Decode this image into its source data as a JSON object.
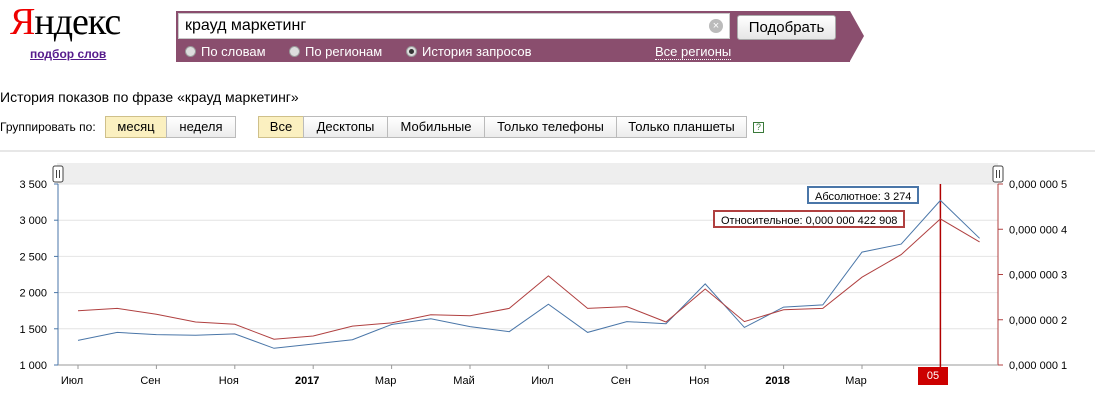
{
  "header": {
    "logo_first": "Я",
    "logo_rest": "ндекс",
    "sublink": "подбор слов",
    "search_value": "крауд маркетинг",
    "clear_glyph": "×",
    "submit_label": "Подобрать",
    "radios": [
      {
        "label": "По словам",
        "selected": false
      },
      {
        "label": "По регионам",
        "selected": false
      },
      {
        "label": "История запросов",
        "selected": true
      }
    ],
    "regions_link": "Все регионы",
    "bar_color": "#8a4e6e"
  },
  "main": {
    "heading": "История показов по фразе «крауд маркетинг»",
    "group_label": "Группировать по:",
    "group_buttons": [
      {
        "label": "месяц",
        "active": true
      },
      {
        "label": "неделя",
        "active": false
      }
    ],
    "device_buttons": [
      {
        "label": "Все",
        "active": true
      },
      {
        "label": "Десктопы",
        "active": false
      },
      {
        "label": "Мобильные",
        "active": false
      },
      {
        "label": "Только телефоны",
        "active": false
      },
      {
        "label": "Только планшеты",
        "active": false
      }
    ],
    "help_glyph": "?"
  },
  "chart_data": {
    "type": "line",
    "x_tick_labels": [
      "Июл",
      "Сен",
      "Ноя",
      "2017",
      "Мар",
      "Май",
      "Июл",
      "Сен",
      "Ноя",
      "2018",
      "Мар",
      "05"
    ],
    "months": [
      "2016-07",
      "2016-08",
      "2016-09",
      "2016-10",
      "2016-11",
      "2016-12",
      "2017-01",
      "2017-02",
      "2017-03",
      "2017-04",
      "2017-05",
      "2017-06",
      "2017-07",
      "2017-08",
      "2017-09",
      "2017-10",
      "2017-11",
      "2017-12",
      "2018-01",
      "2018-02",
      "2018-03",
      "2018-04",
      "2018-05",
      "2018-06"
    ],
    "series": [
      {
        "name": "Абсолютное",
        "color": "#4a76a8",
        "axis": "left",
        "values": [
          1340,
          1450,
          1420,
          1410,
          1430,
          1230,
          1290,
          1350,
          1560,
          1640,
          1530,
          1460,
          1840,
          1450,
          1600,
          1570,
          2120,
          1520,
          1800,
          1830,
          2560,
          2670,
          3274,
          2750
        ]
      },
      {
        "name": "Относительное",
        "color": "#b04040",
        "axis": "right",
        "values": [
          2.2e-07,
          2.25e-07,
          2.12e-07,
          1.95e-07,
          1.9e-07,
          1.57e-07,
          1.64e-07,
          1.86e-07,
          1.93e-07,
          2.11e-07,
          2.09e-07,
          2.25e-07,
          2.97e-07,
          2.25e-07,
          2.29e-07,
          1.95e-07,
          2.68e-07,
          1.96e-07,
          2.22e-07,
          2.25e-07,
          2.94e-07,
          3.44e-07,
          4.22908e-07,
          3.72e-07
        ]
      }
    ],
    "left_axis": {
      "ticks": [
        "1 000",
        "1 500",
        "2 000",
        "2 500",
        "3 000",
        "3 500"
      ],
      "min": 1000,
      "max": 3500
    },
    "right_axis": {
      "ticks": [
        "0,000 000 1",
        "0,000 000 2",
        "0,000 000 3",
        "0,000 000 4",
        "0,000 000 5"
      ],
      "min": 1e-07,
      "max": 5e-07
    },
    "grid": true,
    "highlight_index": 22,
    "tooltip_abs": "Абсолютное: 3 274",
    "tooltip_rel": "Относительное: 0,000 000 422 908"
  }
}
